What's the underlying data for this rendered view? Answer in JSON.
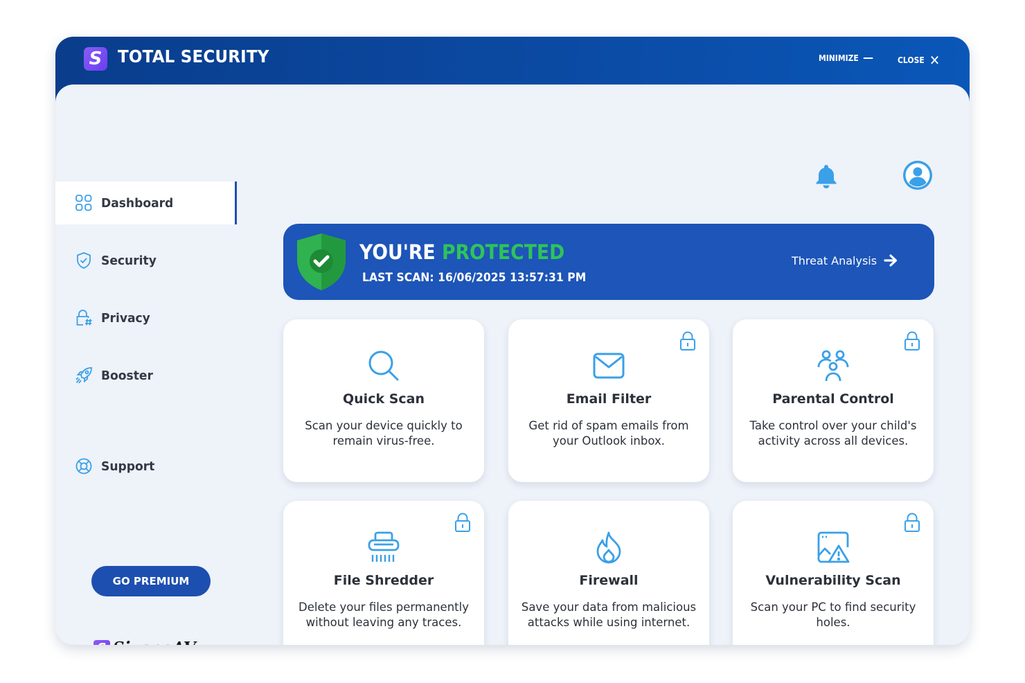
{
  "app": {
    "title": "TOTAL SECURITY",
    "logo_letter": "S",
    "minimize_label": "MINIMIZE",
    "close_label": "CLOSE"
  },
  "header": {
    "notification_icon": "bell-icon",
    "profile_icon": "user-icon"
  },
  "sidebar": {
    "items": [
      {
        "label": "Dashboard",
        "icon": "grid-icon",
        "active": true
      },
      {
        "label": "Security",
        "icon": "shield-icon",
        "active": false
      },
      {
        "label": "Privacy",
        "icon": "lock-hash-icon",
        "active": false
      },
      {
        "label": "Booster",
        "icon": "rocket-icon",
        "active": false
      },
      {
        "label": "Support",
        "icon": "lifebuoy-icon",
        "active": false
      }
    ],
    "premium_button": "GO PREMIUM",
    "brand_name": "SiyanoAV",
    "brand_letter": "S"
  },
  "status": {
    "title_prefix": "YOU'RE",
    "title_status": "PROTECTED",
    "last_scan": "LAST SCAN: 16/06/2025 13:57:31 PM",
    "threat_link": "Threat Analysis"
  },
  "features": [
    {
      "title": "Quick Scan",
      "description": "Scan your device quickly to remain virus-free.",
      "icon": "search-icon",
      "locked": false
    },
    {
      "title": "Email Filter",
      "description": "Get rid of spam emails from your Outlook inbox.",
      "icon": "mail-icon",
      "locked": true
    },
    {
      "title": "Parental Control",
      "description": "Take control over your child's activity across all devices.",
      "icon": "family-icon",
      "locked": true
    },
    {
      "title": "File Shredder",
      "description": "Delete your files permanently without leaving any traces.",
      "icon": "shredder-icon",
      "locked": true
    },
    {
      "title": "Firewall",
      "description": "Save your data from malicious attacks while using internet.",
      "icon": "flame-icon",
      "locked": false
    },
    {
      "title": "Vulnerability Scan",
      "description": "Scan your PC to find security holes.",
      "icon": "warning-window-icon",
      "locked": true
    }
  ],
  "colors": {
    "titlebar": "#0b4aa3",
    "accent": "#1d55b8",
    "protected_green": "#2fc35a",
    "icon_blue": "#3aa0e8",
    "background": "#eef2f9"
  }
}
